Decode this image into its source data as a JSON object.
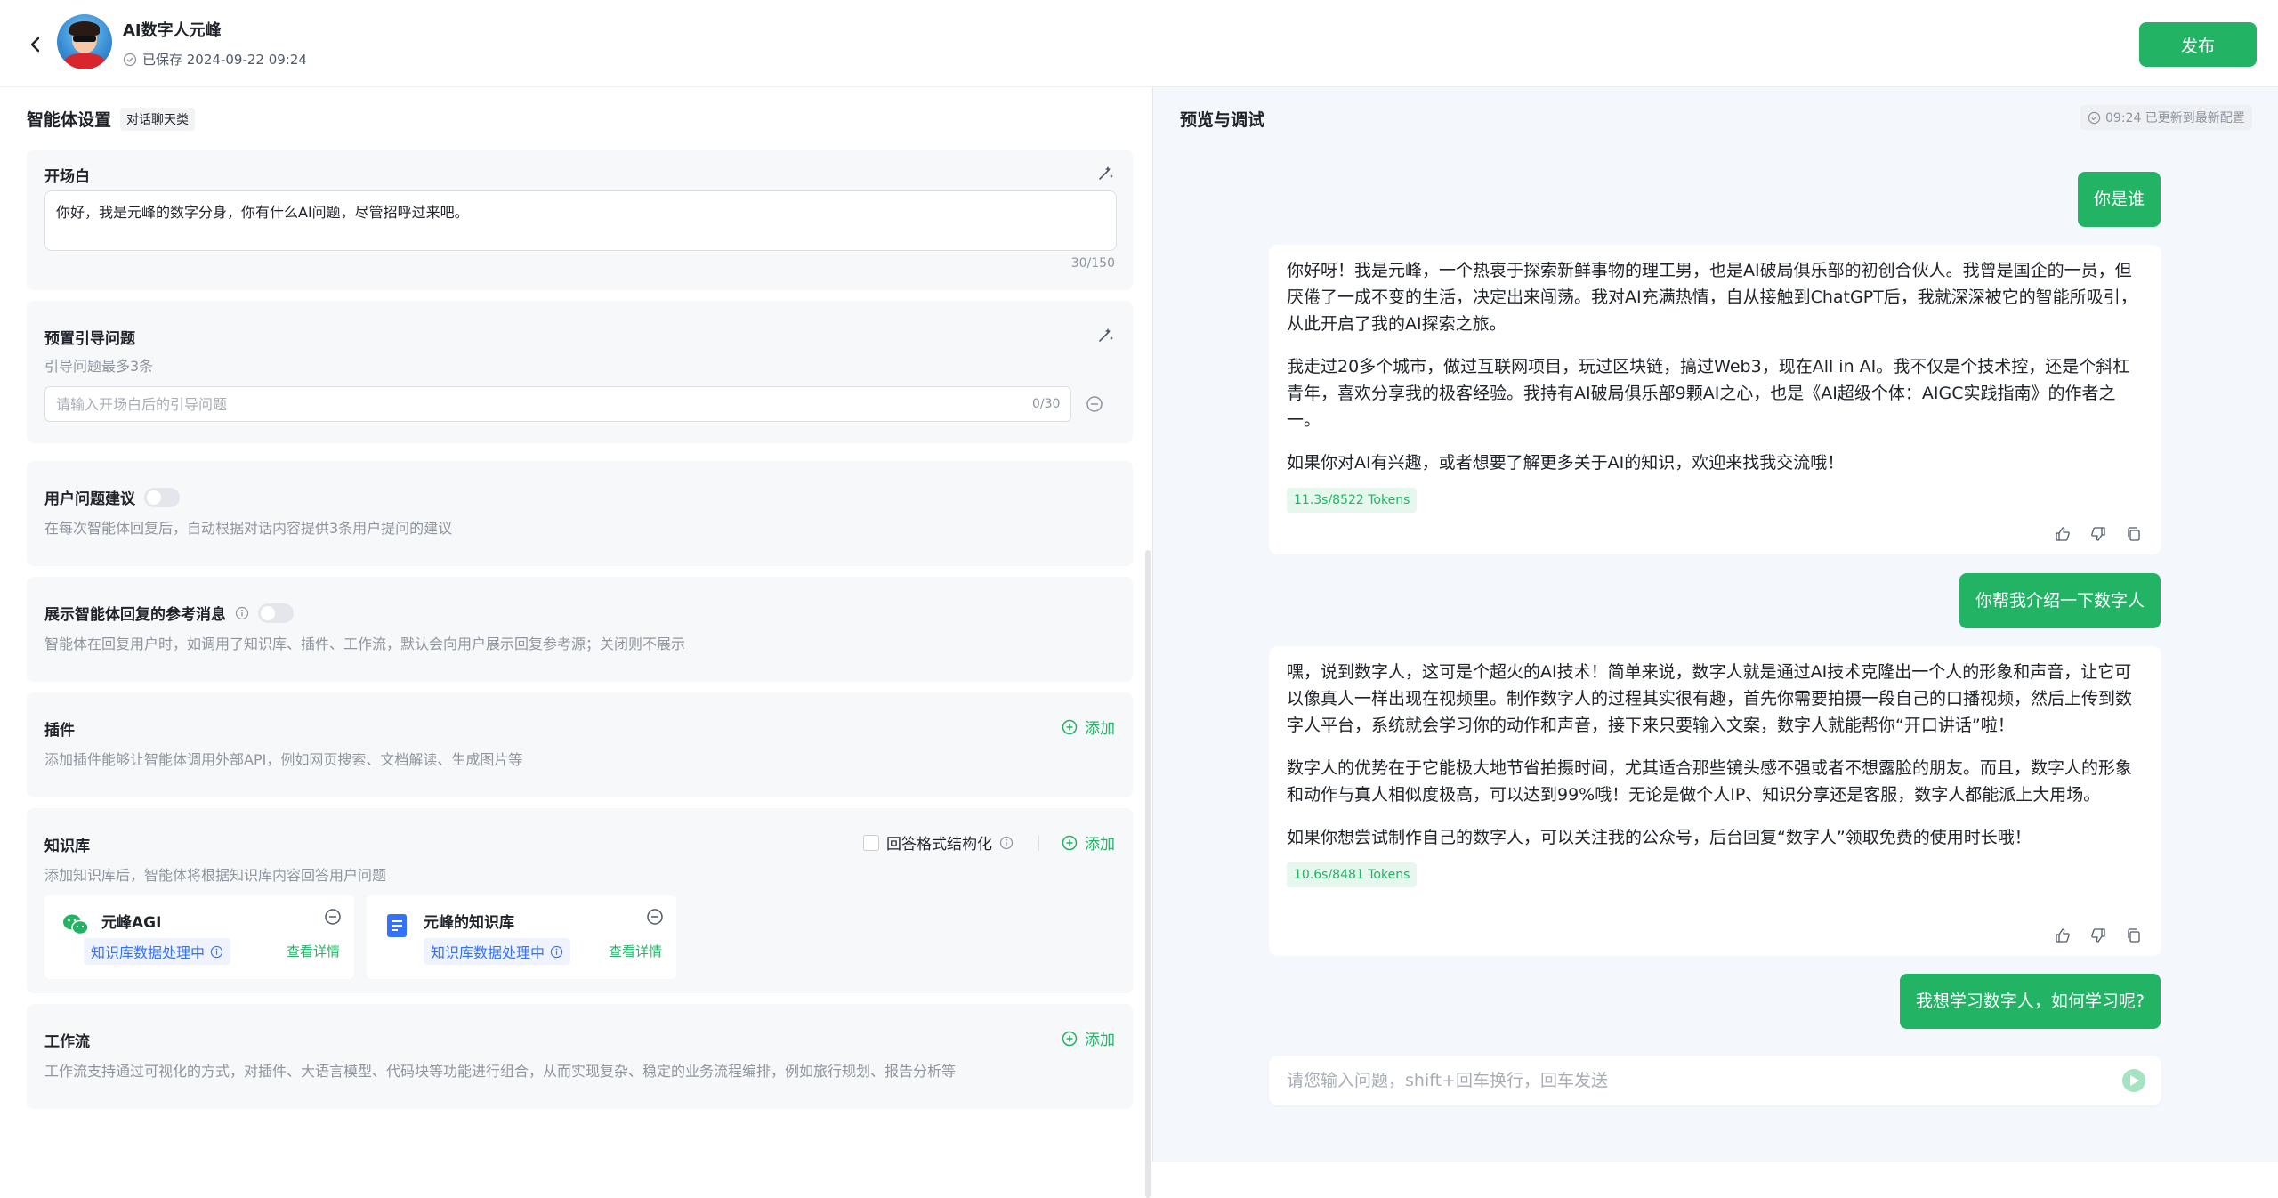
{
  "header": {
    "bot_name": "AI数字人元峰",
    "save_status": "已保存 2024-09-22 09:24",
    "publish_label": "发布"
  },
  "left": {
    "title": "智能体设置",
    "mode_tag": "对话聊天类",
    "opening": {
      "title": "开场白",
      "text": "你好，我是元峰的数字分身，你有什么AI问题，尽管招呼过来吧。",
      "counter": "30/150"
    },
    "guide": {
      "title": "预置引导问题",
      "desc": "引导问题最多3条",
      "placeholder": "请输入开场白后的引导问题",
      "counter": "0/30"
    },
    "suggest": {
      "title": "用户问题建议",
      "desc": "在每次智能体回复后，自动根据对话内容提供3条用户提问的建议"
    },
    "reference": {
      "title": "展示智能体回复的参考消息",
      "desc": "智能体在回复用户时，如调用了知识库、插件、工作流，默认会向用户展示回复参考源；关闭则不展示"
    },
    "plugins": {
      "title": "插件",
      "desc": "添加插件能够让智能体调用外部API，例如网页搜索、文档解读、生成图片等",
      "add_label": "添加"
    },
    "knowledge": {
      "title": "知识库",
      "desc": "添加知识库后，智能体将根据知识库内容回答用户问题",
      "structured_label": "回答格式结构化",
      "add_label": "添加",
      "items": [
        {
          "name": "元峰AGI",
          "status": "知识库数据处理中",
          "detail": "查看详情"
        },
        {
          "name": "元峰的知识库",
          "status": "知识库数据处理中",
          "detail": "查看详情"
        }
      ]
    },
    "workflow": {
      "title": "工作流",
      "desc": "工作流支持通过可视化的方式，对插件、大语言模型、代码块等功能进行组合，从而实现复杂、稳定的业务流程编排，例如旅行规划、报告分析等",
      "add_label": "添加"
    }
  },
  "right": {
    "title": "预览与调试",
    "config_status": "09:24 已更新到最新配置",
    "messages": {
      "q1": "你是谁",
      "a1": {
        "p1": "你好呀！我是元峰，一个热衷于探索新鲜事物的理工男，也是AI破局俱乐部的初创合伙人。我曾是国企的一员，但厌倦了一成不变的生活，决定出来闯荡。我对AI充满热情，自从接触到ChatGPT后，我就深深被它的智能所吸引，从此开启了我的AI探索之旅。",
        "p2": "我走过20多个城市，做过互联网项目，玩过区块链，搞过Web3，现在All in AI。我不仅是个技术控，还是个斜杠青年，喜欢分享我的极客经验。我持有AI破局俱乐部9颗AI之心，也是《AI超级个体：AIGC实践指南》的作者之一。",
        "p3": "如果你对AI有兴趣，或者想要了解更多关于AI的知识，欢迎来找我交流哦！",
        "tokens": "11.3s/8522 Tokens"
      },
      "q2": "你帮我介绍一下数字人",
      "a2": {
        "p1": "嘿，说到数字人，这可是个超火的AI技术！简单来说，数字人就是通过AI技术克隆出一个人的形象和声音，让它可以像真人一样出现在视频里。制作数字人的过程其实很有趣，首先你需要拍摄一段自己的口播视频，然后上传到数字人平台，系统就会学习你的动作和声音，接下来只要输入文案，数字人就能帮你“开口讲话”啦！",
        "p2": "数字人的优势在于它能极大地节省拍摄时间，尤其适合那些镜头感不强或者不想露脸的朋友。而且，数字人的形象和动作与真人相似度极高，可以达到99%哦！无论是做个人IP、知识分享还是客服，数字人都能派上大用场。",
        "p3": "如果你想尝试制作自己的数字人，可以关注我的公众号，后台回复“数字人”领取免费的使用时长哦！",
        "tokens": "10.6s/8481 Tokens"
      },
      "q3": "我想学习数字人，如何学习呢?"
    },
    "input_placeholder": "请您输入问题，shift+回车换行，回车发送"
  },
  "colors": {
    "accent": "#22b364",
    "link": "#3370ff",
    "panel_bg": "#f7f8fa"
  }
}
